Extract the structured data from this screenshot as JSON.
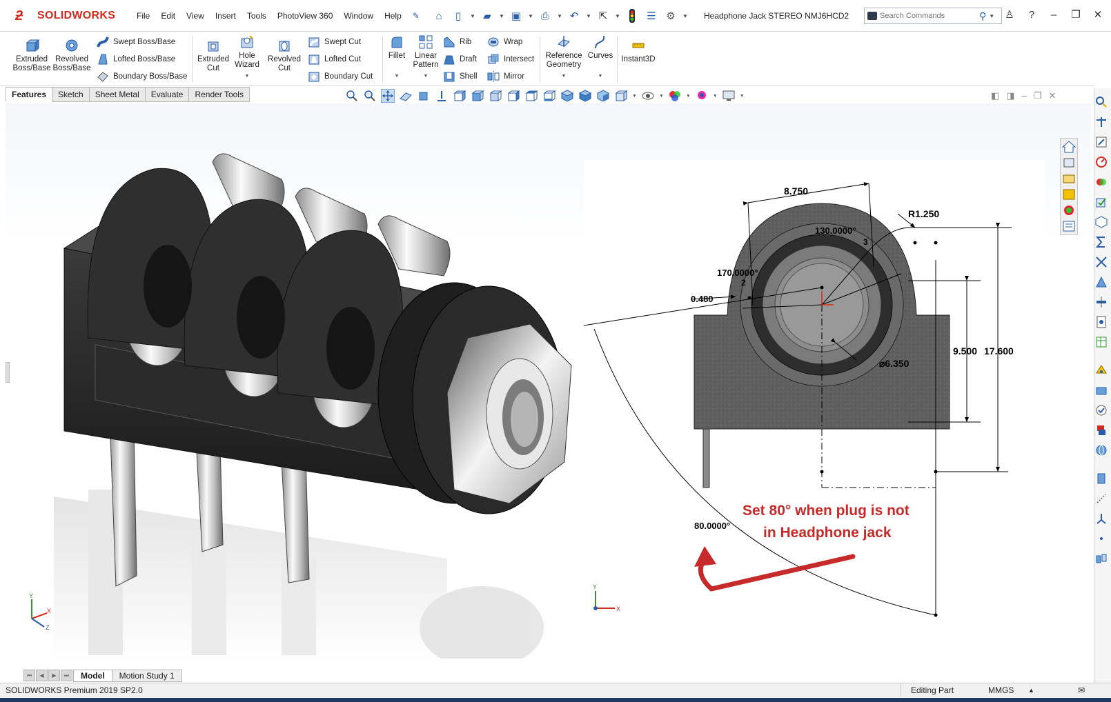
{
  "app": {
    "brand": "SOLIDWORKS",
    "document_title": "Headphone Jack STEREO NMJ6HCD2"
  },
  "menu": [
    "File",
    "Edit",
    "View",
    "Insert",
    "Tools",
    "PhotoView 360",
    "Window",
    "Help"
  ],
  "search": {
    "placeholder": "Search Commands"
  },
  "ribbon": {
    "extruded_boss": "Extruded Boss/Base",
    "revolved_boss": "Revolved Boss/Base",
    "swept_boss": "Swept Boss/Base",
    "lofted_boss": "Lofted Boss/Base",
    "boundary_boss": "Boundary Boss/Base",
    "extruded_cut": "Extruded Cut",
    "hole_wizard": "Hole Wizard",
    "revolved_cut": "Revolved Cut",
    "swept_cut": "Swept Cut",
    "lofted_cut": "Lofted Cut",
    "boundary_cut": "Boundary Cut",
    "fillet": "Fillet",
    "linear_pattern": "Linear Pattern",
    "rib": "Rib",
    "draft": "Draft",
    "shell": "Shell",
    "wrap": "Wrap",
    "intersect": "Intersect",
    "mirror": "Mirror",
    "reference_geometry": "Reference Geometry",
    "curves": "Curves",
    "instant3d": "Instant3D"
  },
  "command_tabs": [
    "Features",
    "Sketch",
    "Sheet Metal",
    "Evaluate",
    "Render Tools"
  ],
  "drawing": {
    "dim_width": "8.750",
    "dim_radius": "R1.250",
    "dim_angle_top": "130.0000°",
    "dim_angle_left": "170.0000°",
    "dim_offset": "0.480",
    "dim_diameter": "⌀6.350",
    "dim_height_inner": "9.500",
    "dim_height_outer": "17.600",
    "dim_angle_arc": "80.0000°",
    "label_2": "2",
    "label_3": "3",
    "note_line1": "Set 80° when plug is not",
    "note_line2": "in Headphone jack"
  },
  "triad": {
    "x": "X",
    "y": "Y",
    "z": "Z"
  },
  "bottom_tabs": [
    "Model",
    "Motion Study 1"
  ],
  "status": {
    "version": "SOLIDWORKS Premium 2019 SP2.0",
    "mode": "Editing Part",
    "units": "MMGS"
  },
  "colors": {
    "brand_red": "#d52b1e",
    "callout_red": "#c62a2a",
    "accent_blue": "#2a5da8",
    "part_gray": "#5f5f5f",
    "jack_black": "#2b2b2b"
  }
}
